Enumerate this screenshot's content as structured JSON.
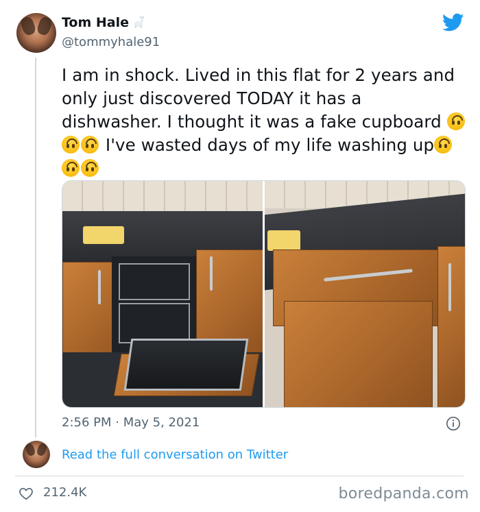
{
  "author": {
    "display_name": "Tom Hale",
    "handle": "@tommyhale91"
  },
  "tweet": {
    "text_before_emoji_1": "I am in shock. Lived in this flat for 2 years and only just discovered TODAY it has a dishwasher. I thought it was a fake cupboard ",
    "text_middle": " I've wasted days of my life washing up",
    "emoji_name": "upside-down-face"
  },
  "timestamp": "2:56 PM · May 5, 2021",
  "read_link": "Read the full conversation on Twitter",
  "likes": "212.4K",
  "watermark": "boredpanda.com",
  "colors": {
    "link": "#1d9bf0",
    "twitter_blue": "#1d9bf0",
    "secondary_text": "#536471"
  },
  "icons": [
    "goat-icon",
    "twitter-bird-icon",
    "info-icon",
    "heart-icon"
  ]
}
